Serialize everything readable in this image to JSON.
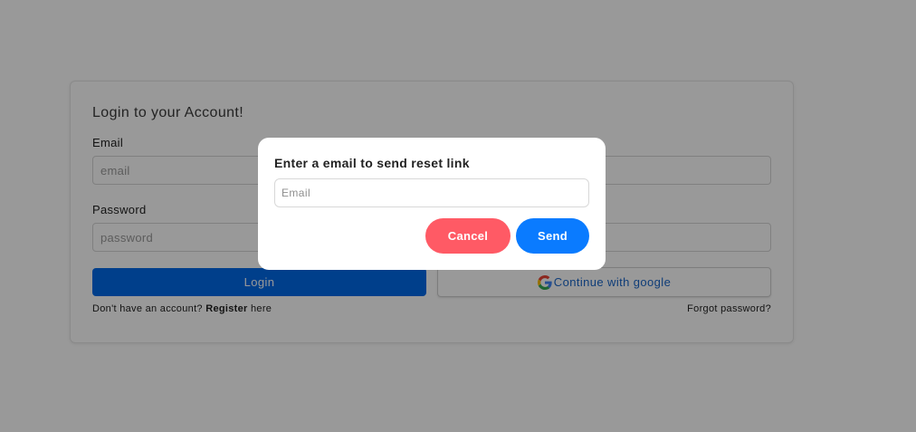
{
  "login_card": {
    "title": "Login to your Account!",
    "email_label": "Email",
    "email_placeholder": "email",
    "password_label": "Password",
    "password_placeholder": "password",
    "login_button": "Login",
    "google_button": "Continue with google",
    "register_prefix": "Don't have an account?",
    "register_link": "Register",
    "register_suffix": "here",
    "forgot_password": "Forgot password?"
  },
  "reset_modal": {
    "title": "Enter a email to send reset link",
    "email_placeholder": "Email",
    "cancel_button": "Cancel",
    "send_button": "Send"
  },
  "colors": {
    "login_button": "#0069e8",
    "google_text": "#1a66c9",
    "cancel_button": "#ff5a65",
    "send_button": "#0a7bff",
    "overlay": "rgba(0,0,0,0.40)"
  },
  "icons": {
    "google": "google-g-icon"
  }
}
